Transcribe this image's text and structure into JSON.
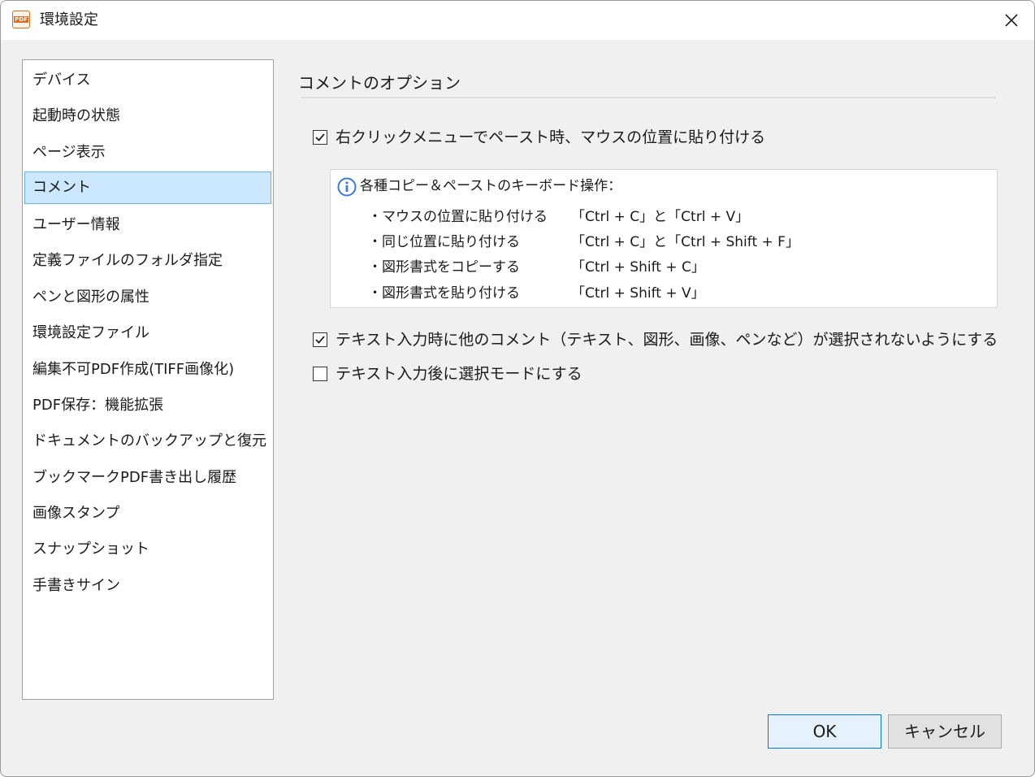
{
  "window": {
    "title": "環境設定",
    "app_icon_text": "PDF"
  },
  "sidebar": {
    "items": [
      {
        "label": "デバイス"
      },
      {
        "label": "起動時の状態"
      },
      {
        "label": "ページ表示"
      },
      {
        "label": "コメント",
        "selected": true
      },
      {
        "label": "ユーザー情報"
      },
      {
        "label": "定義ファイルのフォルダ指定"
      },
      {
        "label": "ペンと図形の属性"
      },
      {
        "label": "環境設定ファイル"
      },
      {
        "label": "編集不可PDF作成(TIFF画像化)"
      },
      {
        "label": "PDF保存：機能拡張"
      },
      {
        "label": "ドキュメントのバックアップと復元"
      },
      {
        "label": "ブックマークPDF書き出し履歴"
      },
      {
        "label": "画像スタンプ"
      },
      {
        "label": "スナップショット"
      },
      {
        "label": "手書きサイン"
      }
    ]
  },
  "main": {
    "section_title": "コメントのオプション",
    "options": [
      {
        "label": "右クリックメニューでペースト時、マウスの位置に貼り付ける",
        "checked": true
      },
      {
        "label": "テキスト入力時に他のコメント（テキスト、図形、画像、ペンなど）が選択されないようにする",
        "checked": true
      },
      {
        "label": "テキスト入力後に選択モードにする",
        "checked": false
      }
    ],
    "info": {
      "title": "各種コピー＆ペーストのキーボード操作：",
      "shortcuts": [
        {
          "action": "・マウスの位置に貼り付ける",
          "keys": "「Ctrl + C」と「Ctrl + V」"
        },
        {
          "action": "・同じ位置に貼り付ける",
          "keys": "「Ctrl + C」と「Ctrl + Shift + F」"
        },
        {
          "action": "・図形書式をコピーする",
          "keys": "「Ctrl + Shift + C」"
        },
        {
          "action": "・図形書式を貼り付ける",
          "keys": "「Ctrl + Shift + V」"
        }
      ]
    }
  },
  "buttons": {
    "ok": "OK",
    "cancel": "キャンセル"
  },
  "colors": {
    "selection_bg": "#cce8ff",
    "selection_border": "#6ab0e6",
    "ok_border": "#0078d7",
    "app_icon": "#e06b1c",
    "info_icon": "#3a7bd5"
  }
}
